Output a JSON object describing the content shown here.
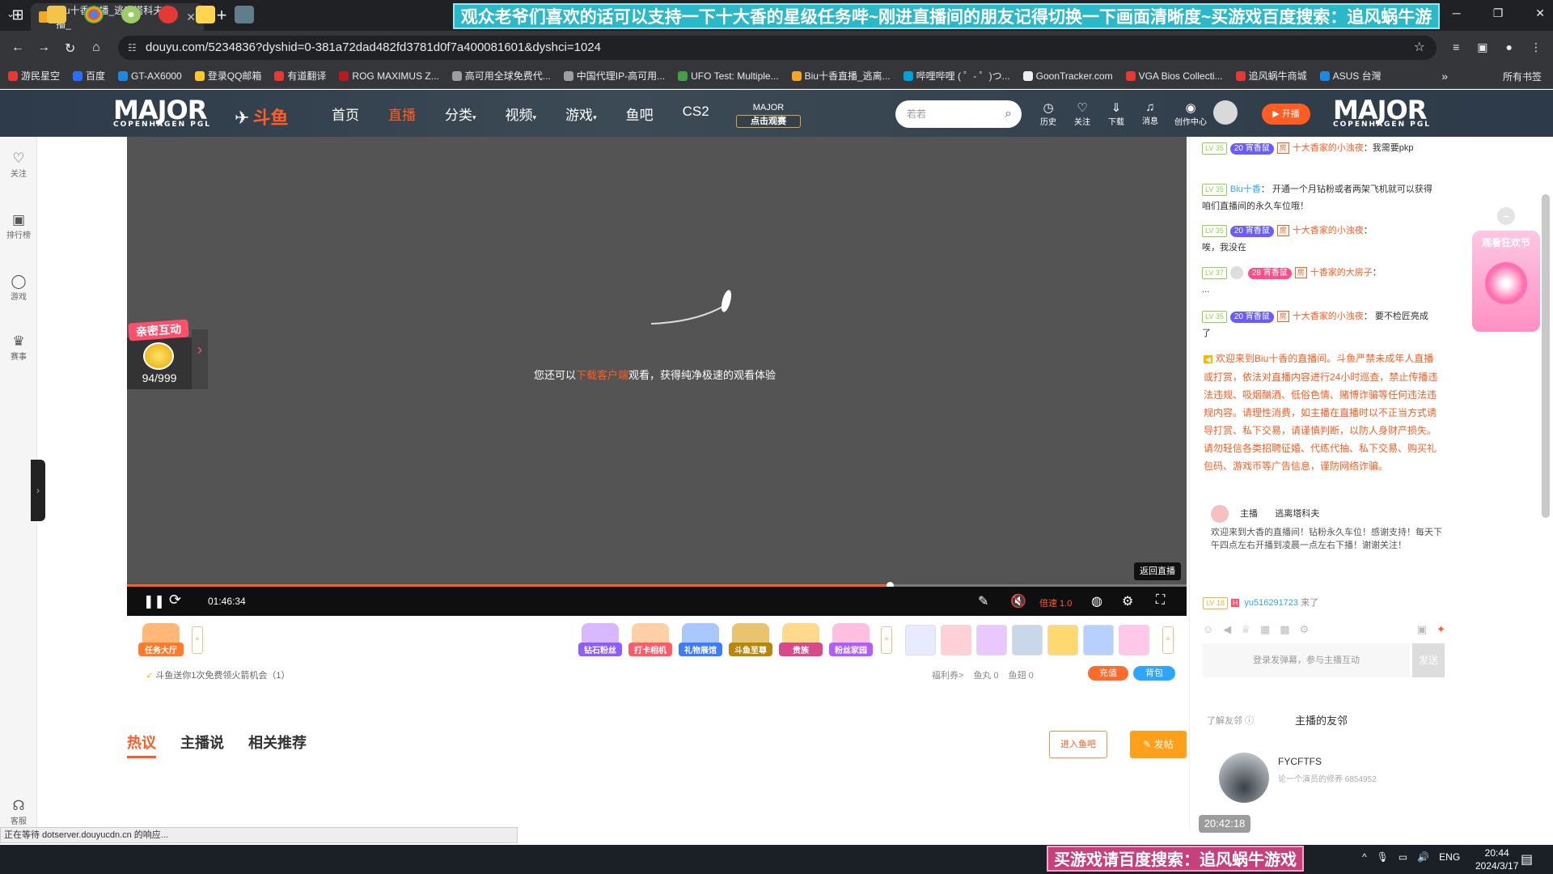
{
  "browser": {
    "tab_title": "Biu十香直播_逃离塔科夫直播_",
    "url": "douyu.com/5234836?dyshid=0-381a72dad482fd3781d0f7a400081601&dyshci=1024",
    "banner_top": "观众老爷们喜欢的话可以支持一下十大香的星级任务哔~刚进直播间的朋友记得切换一下画面清晰度~买游戏百度搜索：追风蜗牛游戏",
    "bookmarks": [
      "游民星空",
      "百度",
      "GT-AX6000",
      "登录QQ邮箱",
      "有道翻译",
      "ROG MAXIMUS Z...",
      "高可用全球免费代...",
      "中国代理IP-高可用...",
      "UFO Test: Multiple...",
      "Biu十香直播_逃离...",
      "哔哩哔哩 ( ゜- ゜)つ...",
      "GoonTracker.com",
      "VGA Bios Collecti...",
      "追风蜗牛商城",
      "ASUS 台灣"
    ],
    "bookmarks_all": "所有书签",
    "status_text": "正在等待 dotserver.douyucdn.cn 的响应..."
  },
  "header": {
    "event_logo": "MAJOR",
    "event_sub": "COPENHAGEN PGL",
    "site_logo": "斗鱼",
    "nav": [
      "首页",
      "直播",
      "分类",
      "视频",
      "游戏",
      "鱼吧",
      "CS2"
    ],
    "major_btn_top": "MAJOR",
    "major_btn_bottom": "点击观赛",
    "search_placeholder": "若若",
    "icons": [
      "历史",
      "关注",
      "下载",
      "消息",
      "创作中心"
    ],
    "live_btn": "开播"
  },
  "sidebar": {
    "items": [
      "关注",
      "排行榜",
      "游戏",
      "赛事",
      "客服"
    ]
  },
  "player": {
    "message_pre": "您还可以",
    "message_link": "下载客户端",
    "message_post": "观看，获得纯净极速的观看体验",
    "interact_title": "亲密互动",
    "interact_count": "94/999",
    "time": "01:46:34",
    "speed": "倍速 1.0",
    "back_live": "返回直播",
    "progress_fraction": 0.72
  },
  "gifts": [
    "钻石粉丝",
    "打卡相机",
    "礼物展馆",
    "斗鱼至尊",
    "贵族",
    "粉丝家园"
  ],
  "gift_left": "任务大厅",
  "promo": "斗鱼送你1次免费领火箭机会（1）",
  "wallet": {
    "welfare": "福利券>",
    "fishball": "鱼丸 0",
    "fishwing": "鱼翅 0",
    "charge": "充值",
    "bag": "背包"
  },
  "tabs": [
    "热议",
    "主播说",
    "相关推荐"
  ],
  "actions": {
    "fishbar": "进入鱼吧",
    "post": "发帖"
  },
  "chat": {
    "messages": [
      {
        "lv": "LV 35",
        "badge": "20 宵香鼠",
        "user": "十大香家的小浊夜",
        "text": "我需要pkp"
      },
      {
        "lv": "LV 35",
        "badge": "",
        "user": "Biu十香",
        "text": "开通一个月钻粉或者两架飞机就可以获得咱们直播间的永久车位哦！"
      },
      {
        "lv": "LV 35",
        "badge": "20 宵香鼠",
        "user": "十大香家的小浊夜",
        "text": "唉，我没在"
      },
      {
        "lv": "LV 37",
        "badge": "28 宵香鼠",
        "user": "十香家的大房子",
        "text": "..."
      },
      {
        "lv": "LV 35",
        "badge": "20 宵香鼠",
        "user": "十大香家的小浊夜",
        "text": "要不检匠亮成了"
      }
    ],
    "notice": "欢迎来到Biu十香的直播间。斗鱼严禁未成年人直播或打赏，依法对直播内容进行24小时巡查，禁止传播违法违规、吸烟酗酒、低俗色情、赌博诈骗等任何违法违规内容。请理性消费，如主播在直播时以不正当方式诱导打赏、私下交易，请谨慎判断，以防人身财产损失。请勿轻信各类招聘征婚、代练代抽、私下交易、购买礼包码、游戏币等广告信息，谨防网络诈骗。",
    "anchor_label": "主播",
    "anchor_game": "逃离塔科夫",
    "welcome": "欢迎来到大香的直播间！钻粉永久车位！感谢支持！每天下午四点左右开播到凌晨一点左右下播！谢谢关注！",
    "arrival_lv": "LV 18",
    "arrival_user": "yu516291723",
    "arrival_text": "来了",
    "input_placeholder": "登录发弹幕，参与主播互动",
    "send": "发送",
    "fans_hint": "了解友邻",
    "fans_title": "主播的友邻",
    "friend_name": "FYCFTFS",
    "friend_desc": "论一个演员的修养 6854952",
    "time_chip": "20:42:18",
    "festival": "观看狂欢节"
  },
  "taskbar": {
    "banner": "买游戏请百度搜索：追风蜗牛游戏",
    "lang": "ENG",
    "clock_time": "20:44",
    "clock_date": "2024/3/17"
  }
}
